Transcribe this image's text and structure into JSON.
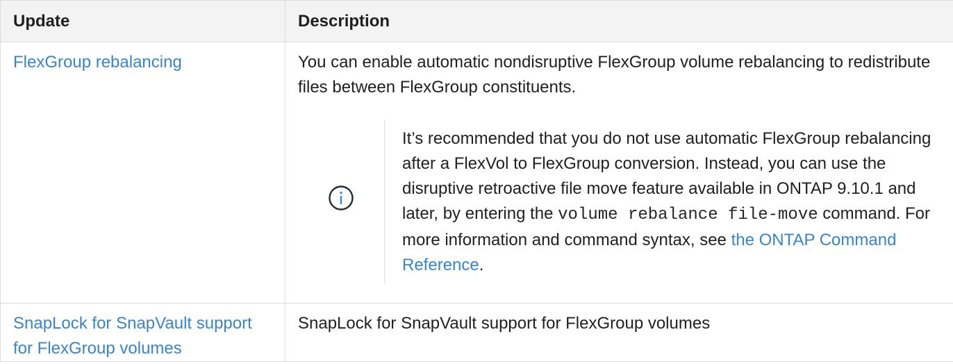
{
  "table": {
    "headers": {
      "update": "Update",
      "description": "Description"
    },
    "rows": [
      {
        "update_link": "FlexGroup rebalancing",
        "description": "You can enable automatic nondisruptive FlexGroup volume rebalancing to redistribute files between FlexGroup constituents.",
        "note": {
          "icon": "info-circle-icon",
          "text_before_code": "It’s recommended that you do not use automatic FlexGroup rebalancing after a FlexVol to FlexGroup conversion. Instead, you can use the disruptive retroactive file move feature available in ONTAP 9.10.1 and later, by entering the ",
          "code": "volume rebalance file-move",
          "text_after_code": " command. For more information and command syntax, see ",
          "link": "the ONTAP Command Reference",
          "end": "."
        }
      },
      {
        "update_link": "SnapLock for SnapVault support for FlexGroup volumes",
        "description": "SnapLock for SnapVault support for FlexGroup volumes"
      }
    ]
  },
  "colors": {
    "link": "#3a85c6",
    "header_bg": "#f3f3f3",
    "border": "#dcdcdc",
    "icon": "#1f2a33"
  }
}
